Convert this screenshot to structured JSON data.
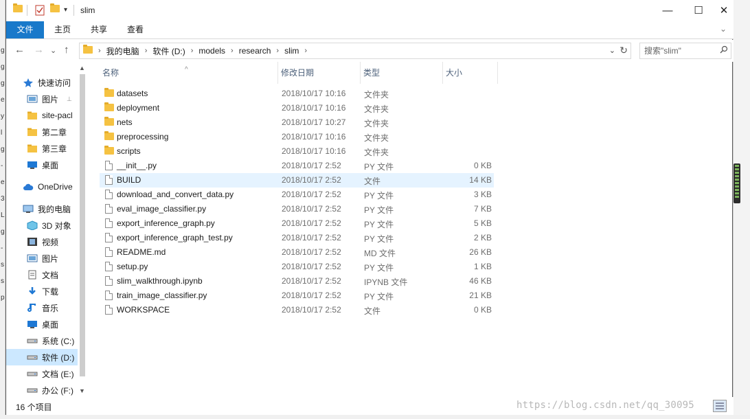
{
  "window": {
    "title": "slim",
    "minimize_glyph": "—",
    "maximize_glyph": "☐",
    "close_glyph": "✕"
  },
  "ribbon": {
    "tabs": [
      "文件",
      "主页",
      "共享",
      "查看"
    ],
    "expand_glyph": "⌄"
  },
  "nav_buttons": {
    "back": "←",
    "forward": "→",
    "recent": "⌄",
    "up": "↑"
  },
  "address": {
    "crumbs": [
      "我的电脑",
      "软件 (D:)",
      "models",
      "research",
      "slim"
    ],
    "separator": "›",
    "dropdown": "⌄",
    "refresh": "↻"
  },
  "search": {
    "placeholder": "搜索\"slim\"",
    "icon": "search-icon"
  },
  "navpane": {
    "items": [
      {
        "label": "快速访问",
        "icon": "star-icon"
      },
      {
        "label": "图片",
        "icon": "pictures-icon",
        "pinned": true
      },
      {
        "label": "site-pacl",
        "icon": "folder-icon"
      },
      {
        "label": "第二章",
        "icon": "folder-icon"
      },
      {
        "label": "第三章",
        "icon": "folder-icon"
      },
      {
        "label": "桌面",
        "icon": "desktop-icon"
      },
      {
        "label": "OneDrive",
        "icon": "cloud-icon"
      },
      {
        "label": "我的电脑",
        "icon": "computer-icon"
      },
      {
        "label": "3D 对象",
        "icon": "cube-icon"
      },
      {
        "label": "视频",
        "icon": "video-icon"
      },
      {
        "label": "图片",
        "icon": "pictures-icon"
      },
      {
        "label": "文档",
        "icon": "document-icon"
      },
      {
        "label": "下载",
        "icon": "download-icon"
      },
      {
        "label": "音乐",
        "icon": "music-icon"
      },
      {
        "label": "桌面",
        "icon": "desktop-icon"
      },
      {
        "label": "系统 (C:)",
        "icon": "drive-icon"
      },
      {
        "label": "软件 (D:)",
        "icon": "drive-icon",
        "selected": true
      },
      {
        "label": "文档 (E:)",
        "icon": "drive-icon"
      },
      {
        "label": "办公 (F:)",
        "icon": "drive-icon"
      }
    ],
    "pin_glyph": "📌"
  },
  "columns": {
    "name": "名称",
    "date": "修改日期",
    "type": "类型",
    "size": "大小",
    "sort_glyph": "^"
  },
  "files": [
    {
      "name": "datasets",
      "date": "2018/10/17 10:16",
      "type": "文件夹",
      "size": "",
      "kind": "folder"
    },
    {
      "name": "deployment",
      "date": "2018/10/17 10:16",
      "type": "文件夹",
      "size": "",
      "kind": "folder"
    },
    {
      "name": "nets",
      "date": "2018/10/17 10:27",
      "type": "文件夹",
      "size": "",
      "kind": "folder"
    },
    {
      "name": "preprocessing",
      "date": "2018/10/17 10:16",
      "type": "文件夹",
      "size": "",
      "kind": "folder"
    },
    {
      "name": "scripts",
      "date": "2018/10/17 10:16",
      "type": "文件夹",
      "size": "",
      "kind": "folder"
    },
    {
      "name": "__init__.py",
      "date": "2018/10/17 2:52",
      "type": "PY 文件",
      "size": "0 KB",
      "kind": "file"
    },
    {
      "name": "BUILD",
      "date": "2018/10/17 2:52",
      "type": "文件",
      "size": "14 KB",
      "kind": "file",
      "highlight": true
    },
    {
      "name": "download_and_convert_data.py",
      "date": "2018/10/17 2:52",
      "type": "PY 文件",
      "size": "3 KB",
      "kind": "file"
    },
    {
      "name": "eval_image_classifier.py",
      "date": "2018/10/17 2:52",
      "type": "PY 文件",
      "size": "7 KB",
      "kind": "file"
    },
    {
      "name": "export_inference_graph.py",
      "date": "2018/10/17 2:52",
      "type": "PY 文件",
      "size": "5 KB",
      "kind": "file"
    },
    {
      "name": "export_inference_graph_test.py",
      "date": "2018/10/17 2:52",
      "type": "PY 文件",
      "size": "2 KB",
      "kind": "file"
    },
    {
      "name": "README.md",
      "date": "2018/10/17 2:52",
      "type": "MD 文件",
      "size": "26 KB",
      "kind": "file"
    },
    {
      "name": "setup.py",
      "date": "2018/10/17 2:52",
      "type": "PY 文件",
      "size": "1 KB",
      "kind": "file"
    },
    {
      "name": "slim_walkthrough.ipynb",
      "date": "2018/10/17 2:52",
      "type": "IPYNB 文件",
      "size": "46 KB",
      "kind": "file"
    },
    {
      "name": "train_image_classifier.py",
      "date": "2018/10/17 2:52",
      "type": "PY 文件",
      "size": "21 KB",
      "kind": "file"
    },
    {
      "name": "WORKSPACE",
      "date": "2018/10/17 2:52",
      "type": "文件",
      "size": "0 KB",
      "kind": "file"
    }
  ],
  "status": {
    "count": "16 个项目"
  },
  "watermark": "https://blog.csdn.net/qq_30095",
  "background_left_chars": [
    "g",
    "g",
    "g",
    "e",
    "y",
    "l",
    "g",
    "-",
    "e",
    "3",
    "L",
    "g",
    "-",
    "s",
    "s",
    "p"
  ],
  "colors": {
    "accent": "#1979ca",
    "selected": "#cce8ff",
    "hover": "#e5f3ff",
    "folder": "#f5c242"
  }
}
